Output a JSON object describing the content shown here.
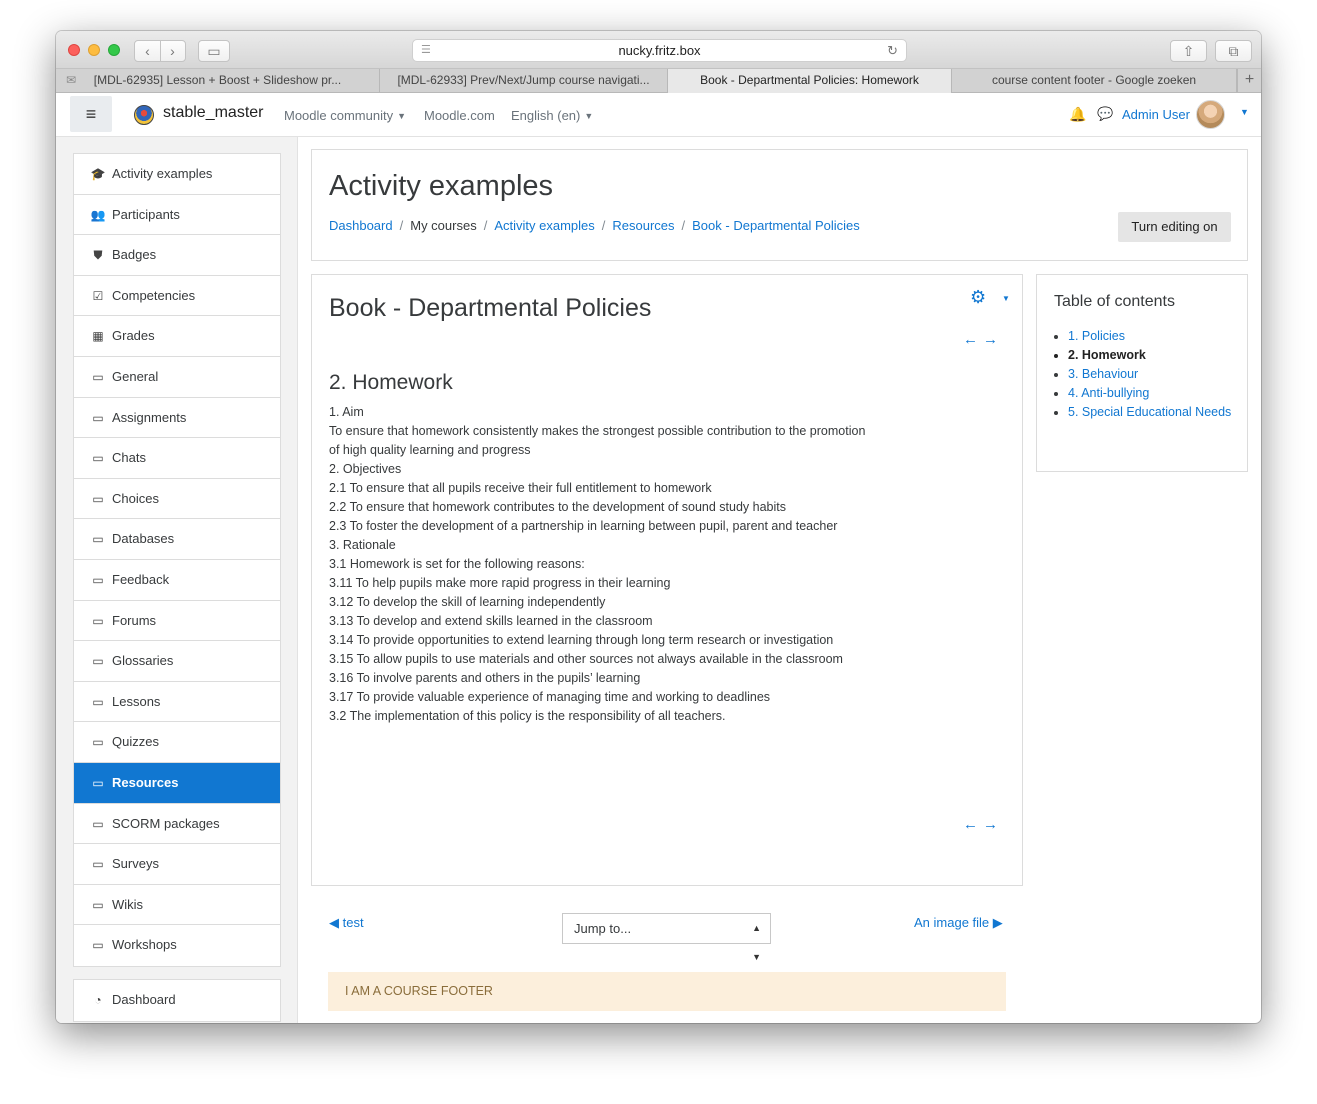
{
  "browser": {
    "url": "nucky.fritz.box",
    "tabs": [
      "[MDL-62935] Lesson + Boost + Slideshow pr...",
      "[MDL-62933] Prev/Next/Jump course navigati...",
      "Book - Departmental Policies: Homework",
      "course content footer - Google zoeken"
    ]
  },
  "navbar": {
    "site_name": "stable_master",
    "links": [
      "Moodle community",
      "Moodle.com",
      "English (en)"
    ],
    "user_name": "Admin User"
  },
  "drawer": {
    "items": [
      {
        "label": "Activity examples",
        "icon": "graduation-cap-icon"
      },
      {
        "label": "Participants",
        "icon": "users-icon"
      },
      {
        "label": "Badges",
        "icon": "shield-icon"
      },
      {
        "label": "Competencies",
        "icon": "check-square-icon"
      },
      {
        "label": "Grades",
        "icon": "table-icon"
      },
      {
        "label": "General",
        "icon": "folder-icon"
      },
      {
        "label": "Assignments",
        "icon": "folder-icon"
      },
      {
        "label": "Chats",
        "icon": "folder-icon"
      },
      {
        "label": "Choices",
        "icon": "folder-icon"
      },
      {
        "label": "Databases",
        "icon": "folder-icon"
      },
      {
        "label": "Feedback",
        "icon": "folder-icon"
      },
      {
        "label": "Forums",
        "icon": "folder-icon"
      },
      {
        "label": "Glossaries",
        "icon": "folder-icon"
      },
      {
        "label": "Lessons",
        "icon": "folder-icon"
      },
      {
        "label": "Quizzes",
        "icon": "folder-icon"
      },
      {
        "label": "Resources",
        "icon": "folder-icon"
      },
      {
        "label": "SCORM packages",
        "icon": "folder-icon"
      },
      {
        "label": "Surveys",
        "icon": "folder-icon"
      },
      {
        "label": "Wikis",
        "icon": "folder-icon"
      },
      {
        "label": "Workshops",
        "icon": "folder-icon"
      }
    ],
    "active_item": "Resources",
    "secondary_items": [
      {
        "label": "Dashboard",
        "icon": "tachometer-icon"
      }
    ]
  },
  "header": {
    "title": "Activity examples",
    "breadcrumb": [
      "Dashboard",
      "My courses",
      "Activity examples",
      "Resources",
      "Book - Departmental Policies"
    ],
    "edit_button": "Turn editing on"
  },
  "book": {
    "title": "Book - Departmental Policies",
    "chapter_title": "2. Homework",
    "content": [
      "1. Aim",
      "To ensure that homework consistently makes the strongest possible contribution to the promotion of high quality learning and progress",
      "2. Objectives",
      "2.1 To ensure that all pupils receive their full entitlement to homework",
      "2.2 To ensure that homework contributes to the development of sound study habits",
      "2.3 To foster the development of a partnership in learning between pupil, parent and teacher",
      "3. Rationale",
      "3.1 Homework is set for the following reasons:",
      "3.11 To help pupils make more rapid progress in their learning",
      "3.12 To develop the skill of learning independently",
      "3.13 To develop and extend skills learned in the classroom",
      "3.14 To provide opportunities to extend learning through long term research or investigation",
      "3.15 To allow pupils to use materials and other sources not always available in the classroom",
      "3.16 To involve parents and others in the pupils’ learning",
      "3.17 To provide valuable experience of managing time and working to deadlines",
      "3.2 The implementation of this policy is the responsibility of all teachers."
    ]
  },
  "toc": {
    "title": "Table of contents",
    "items": [
      "1. Policies",
      "2. Homework",
      "3. Behaviour",
      "4. Anti-bullying",
      "5. Special Educational Needs"
    ],
    "current": "2. Homework"
  },
  "footer_nav": {
    "prev": "test",
    "next": "An image file",
    "jump_placeholder": "Jump to..."
  },
  "course_footer": "I AM A COURSE FOOTER",
  "colors": {
    "accent": "#1177d1",
    "footer_bg": "#fcefdc",
    "footer_text": "#8a6d3b"
  }
}
